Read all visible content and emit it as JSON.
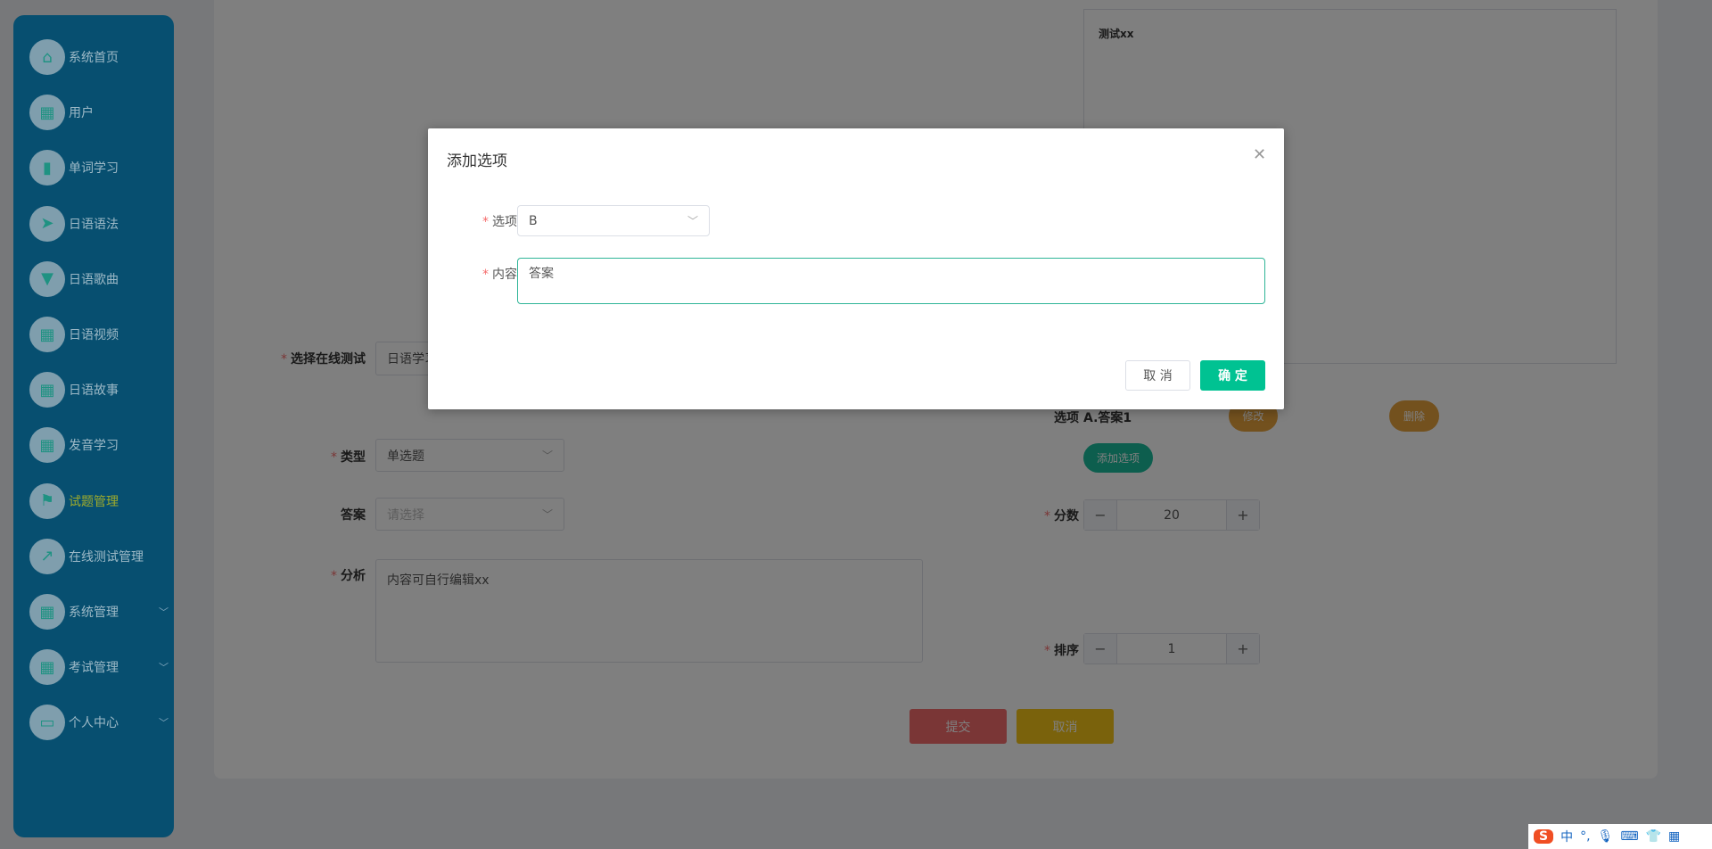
{
  "sidebar": {
    "items": [
      {
        "label": "系统首页",
        "icon": "home-icon"
      },
      {
        "label": "用户",
        "icon": "grid-icon"
      },
      {
        "label": "单词学习",
        "icon": "book-icon"
      },
      {
        "label": "日语语法",
        "icon": "paper-plane-icon"
      },
      {
        "label": "日语歌曲",
        "icon": "paint-roller-icon"
      },
      {
        "label": "日语视频",
        "icon": "grid-icon"
      },
      {
        "label": "日语故事",
        "icon": "grid-icon"
      },
      {
        "label": "发音学习",
        "icon": "grid-icon"
      },
      {
        "label": "试题管理",
        "icon": "flag-icon",
        "active": true
      },
      {
        "label": "在线测试管理",
        "icon": "chart-icon"
      },
      {
        "label": "系统管理",
        "icon": "grid-icon",
        "expandable": true
      },
      {
        "label": "考试管理",
        "icon": "grid-icon",
        "expandable": true
      },
      {
        "label": "个人中心",
        "icon": "wallet-icon",
        "expandable": true
      }
    ],
    "active_color": "#ffe600"
  },
  "form": {
    "question_text": "测试xx",
    "online_test_label": "选择在线测试",
    "online_test_value": "日语学习",
    "options_label": "选项",
    "option_a": "A.答案1",
    "edit_label": "修改",
    "delete_label": "删除",
    "add_option_label": "添加选项",
    "type_label": "类型",
    "type_value": "单选题",
    "answer_label": "答案",
    "answer_placeholder": "请选择",
    "score_label": "分数",
    "score_value": "20",
    "analysis_label": "分析",
    "analysis_value": "内容可自行编辑xx",
    "order_label": "排序",
    "order_value": "1",
    "submit_label": "提交",
    "cancel_label": "取消"
  },
  "dialog": {
    "title": "添加选项",
    "option_label": "选项",
    "option_value": "B",
    "content_label": "内容",
    "content_value": "答案",
    "cancel_label": "取 消",
    "confirm_label": "确 定",
    "accent": "#00c292"
  },
  "ime": {
    "lang": "中",
    "punct": "°,"
  }
}
